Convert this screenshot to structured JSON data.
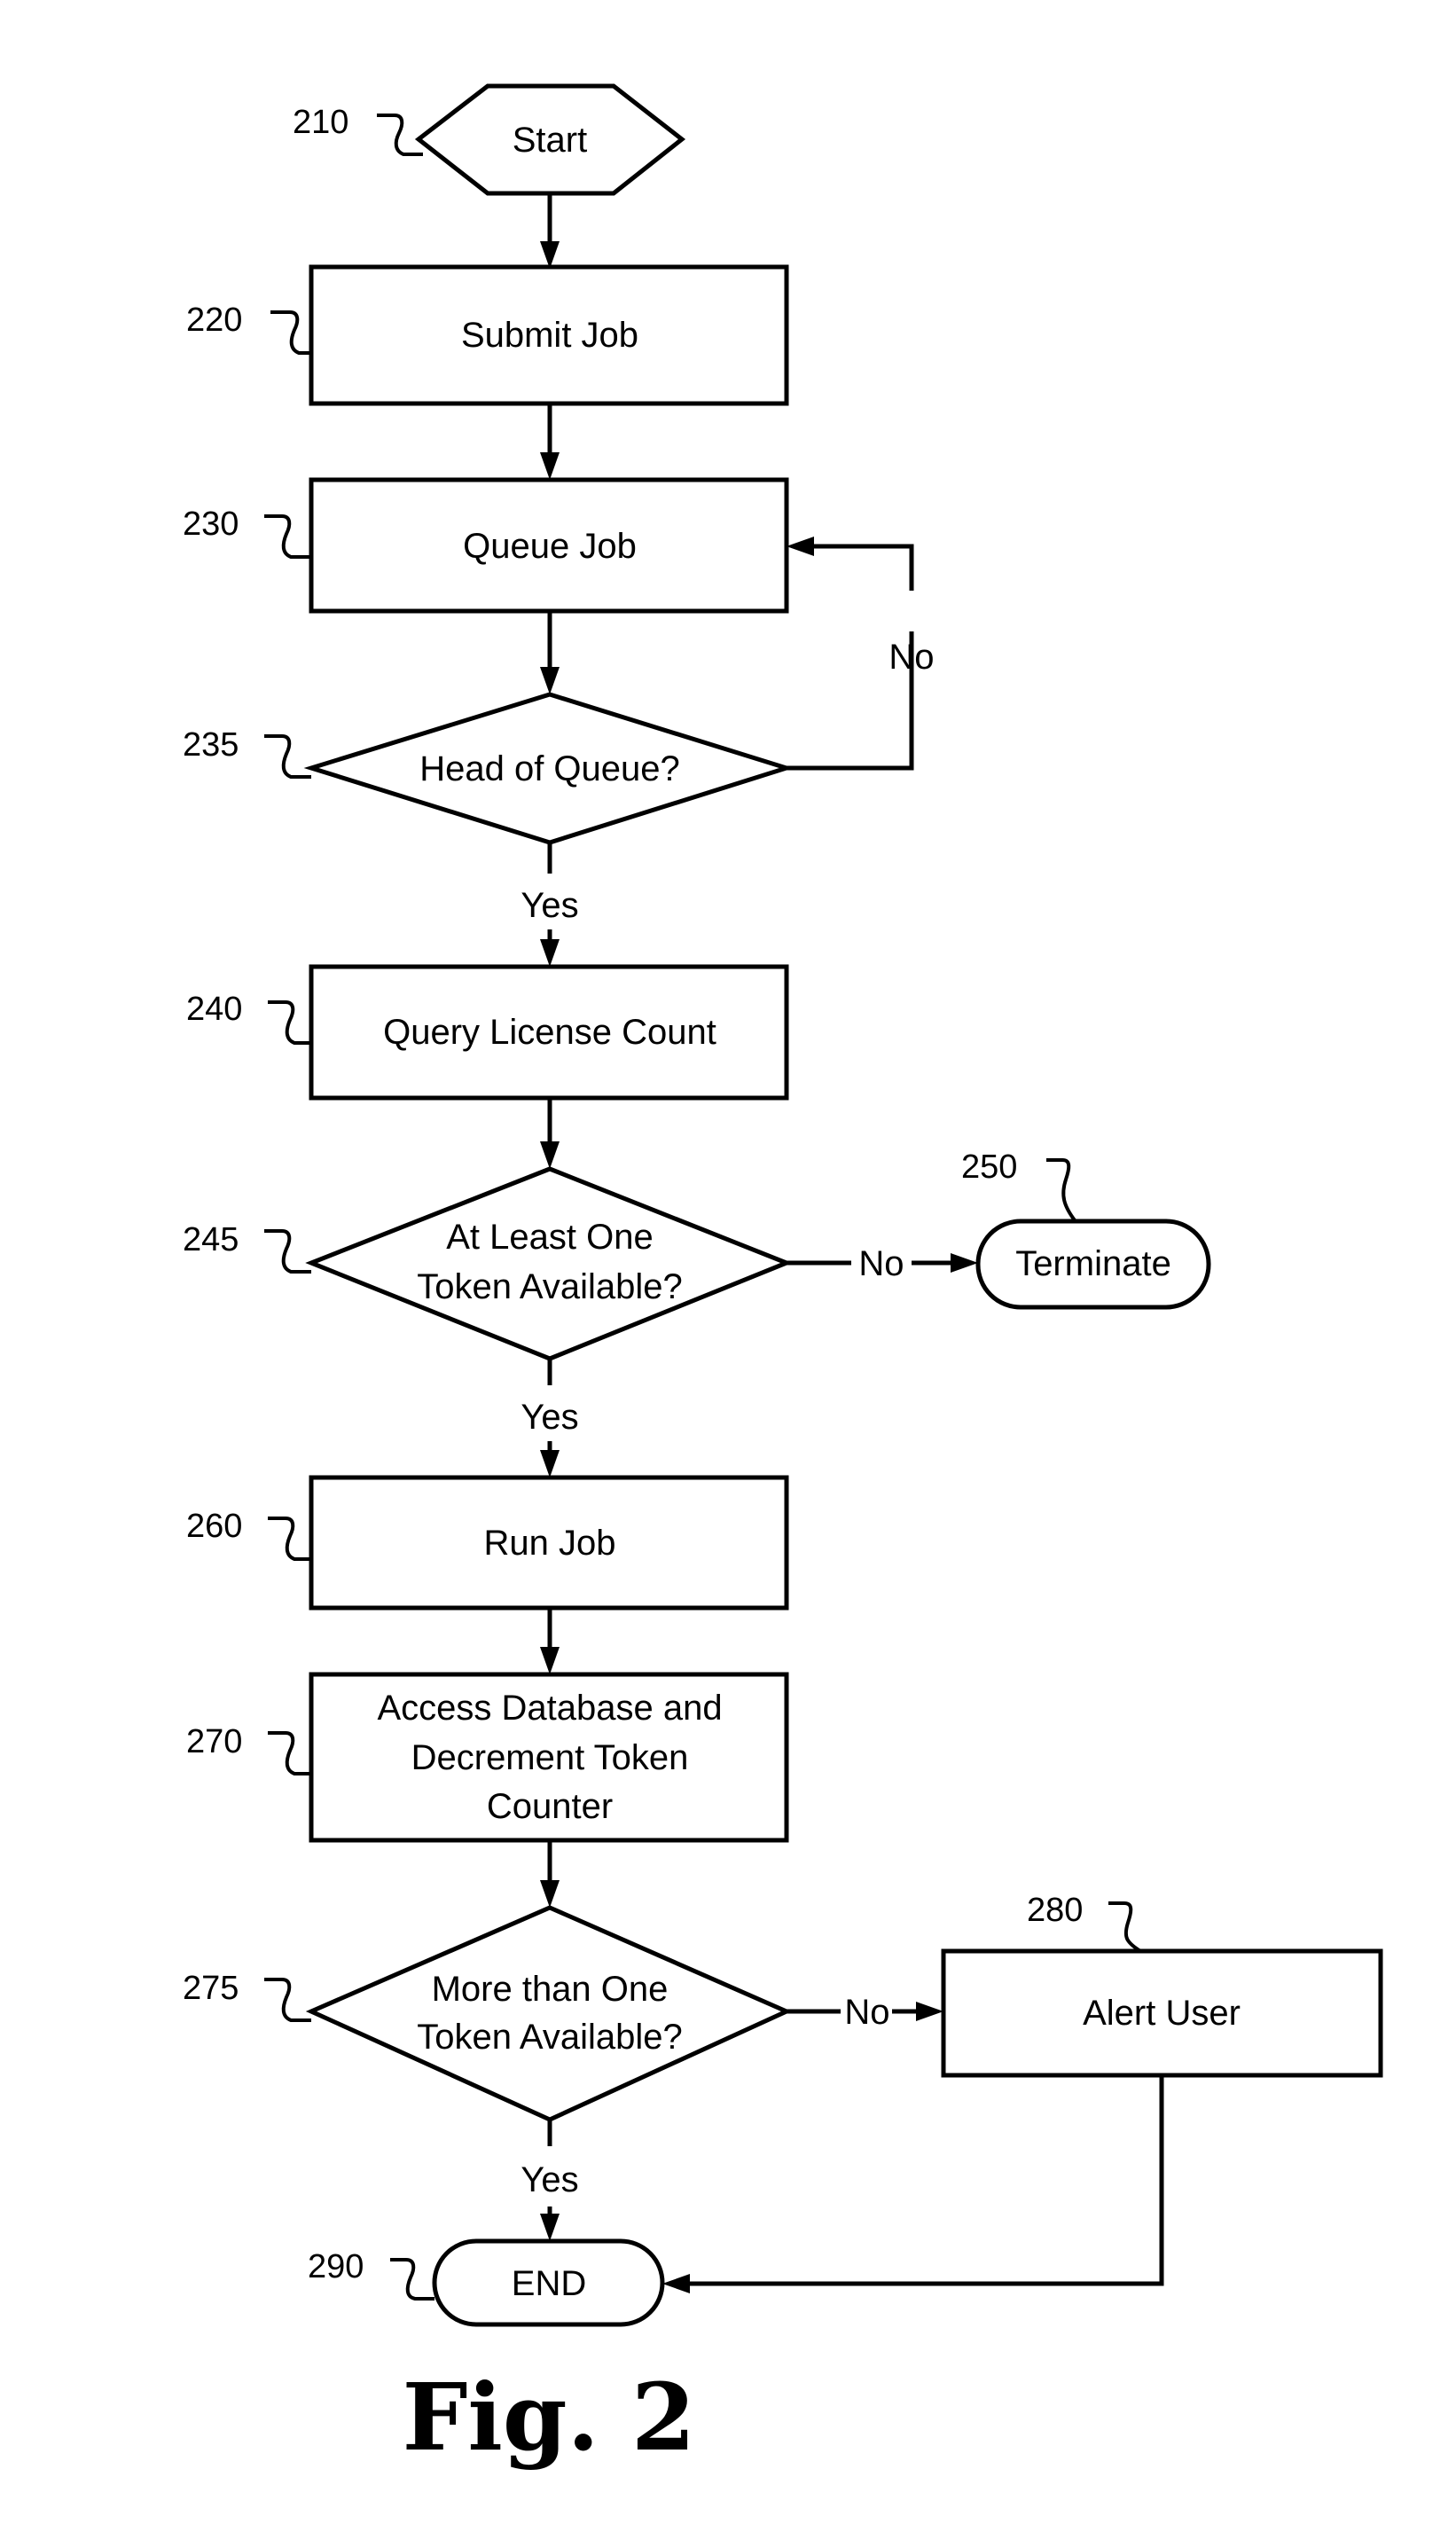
{
  "figure": {
    "caption": "Fig. 2",
    "nodes": [
      {
        "id": "210",
        "type": "start",
        "label": "Start"
      },
      {
        "id": "220",
        "type": "process",
        "label": "Submit Job"
      },
      {
        "id": "230",
        "type": "process",
        "label": "Queue Job"
      },
      {
        "id": "235",
        "type": "decision",
        "label": "Head of Queue?"
      },
      {
        "id": "240",
        "type": "process",
        "label": "Query License Count"
      },
      {
        "id": "245",
        "type": "decision",
        "label_lines": [
          "At Least One",
          "Token Available?"
        ]
      },
      {
        "id": "250",
        "type": "terminal",
        "label": "Terminate"
      },
      {
        "id": "260",
        "type": "process",
        "label": "Run Job"
      },
      {
        "id": "270",
        "type": "process",
        "label_lines": [
          "Access Database and",
          "Decrement Token",
          "Counter"
        ]
      },
      {
        "id": "275",
        "type": "decision",
        "label_lines": [
          "More than One",
          "Token Available?"
        ]
      },
      {
        "id": "280",
        "type": "process",
        "label": "Alert User"
      },
      {
        "id": "290",
        "type": "terminal",
        "label": "END"
      }
    ],
    "edges": [
      {
        "from": "210",
        "to": "220",
        "label": ""
      },
      {
        "from": "220",
        "to": "230",
        "label": ""
      },
      {
        "from": "230",
        "to": "235",
        "label": ""
      },
      {
        "from": "235",
        "to": "230",
        "label": "No"
      },
      {
        "from": "235",
        "to": "240",
        "label": "Yes"
      },
      {
        "from": "240",
        "to": "245",
        "label": ""
      },
      {
        "from": "245",
        "to": "250",
        "label": "No"
      },
      {
        "from": "245",
        "to": "260",
        "label": "Yes"
      },
      {
        "from": "260",
        "to": "270",
        "label": ""
      },
      {
        "from": "270",
        "to": "275",
        "label": ""
      },
      {
        "from": "275",
        "to": "280",
        "label": "No"
      },
      {
        "from": "275",
        "to": "290",
        "label": "Yes"
      },
      {
        "from": "280",
        "to": "290",
        "label": ""
      }
    ],
    "edge_labels": {
      "no": "No",
      "yes": "Yes"
    }
  }
}
